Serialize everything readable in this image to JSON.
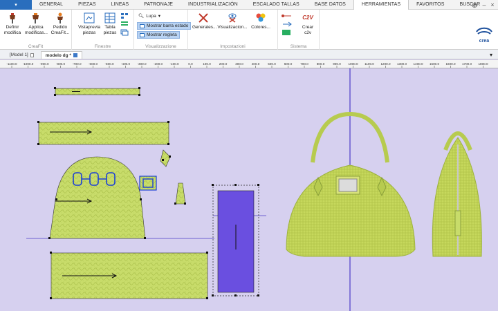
{
  "menu": {
    "items": [
      "GENERAL",
      "PIEZAS",
      "LINEAS",
      "PATRONAJE",
      "INDUSTRIALIZACIÓN",
      "ESCALADO TALLAS",
      "BASE DATOS",
      "HERRAMIENTAS",
      "FAVORITOS",
      "BUSCAR"
    ],
    "active": "HERRAMIENTAS"
  },
  "ribbon": {
    "crea_fit": {
      "label": "CreaFit",
      "buttons": [
        "Definir\nmodifica",
        "Applica\nmodificas...",
        "Pedido\nCreaFit..."
      ]
    },
    "finestre": {
      "label": "Finestre",
      "buttons": [
        "Vistaprevia\npiezas",
        "Tabla\npiezas"
      ]
    },
    "visualizzazione": {
      "label": "Visualizzazione",
      "lupa": "Lupa",
      "toggle1": "Mostrar barra estado",
      "toggle2": "Mostrar regleta"
    },
    "impostazioni": {
      "label": "Impostazioni",
      "buttons": [
        "Generales...",
        "Visualizacion...",
        "Colores..."
      ]
    },
    "sistema": {
      "label": "Sistema",
      "crear": "Crear\nc2v",
      "c2v": "C2V"
    }
  },
  "logo": "crea",
  "tabs": [
    "[Model 1]",
    "modelo dg *"
  ],
  "ruler": [
    "-1100.0",
    "-1000.0",
    "-900.0",
    "-800.0",
    "-700.0",
    "-600.0",
    "-500.0",
    "-400.0",
    "-300.0",
    "-200.0",
    "-100.0",
    "0.0",
    "100.0",
    "200.0",
    "300.0",
    "400.0",
    "500.0",
    "600.0",
    "700.0",
    "800.0",
    "900.0",
    "1000.0",
    "1100.0",
    "1200.0",
    "1300.0",
    "1400.0",
    "1500.0",
    "1600.0",
    "1700.0",
    "1800.0"
  ],
  "colors": {
    "canvas": "#d6d0ef",
    "piece_fill": "#c8dc6a",
    "selected_piece": "#6a4fe0",
    "guide_line": "#4a3bc7",
    "accent": "#2a6ebd"
  }
}
